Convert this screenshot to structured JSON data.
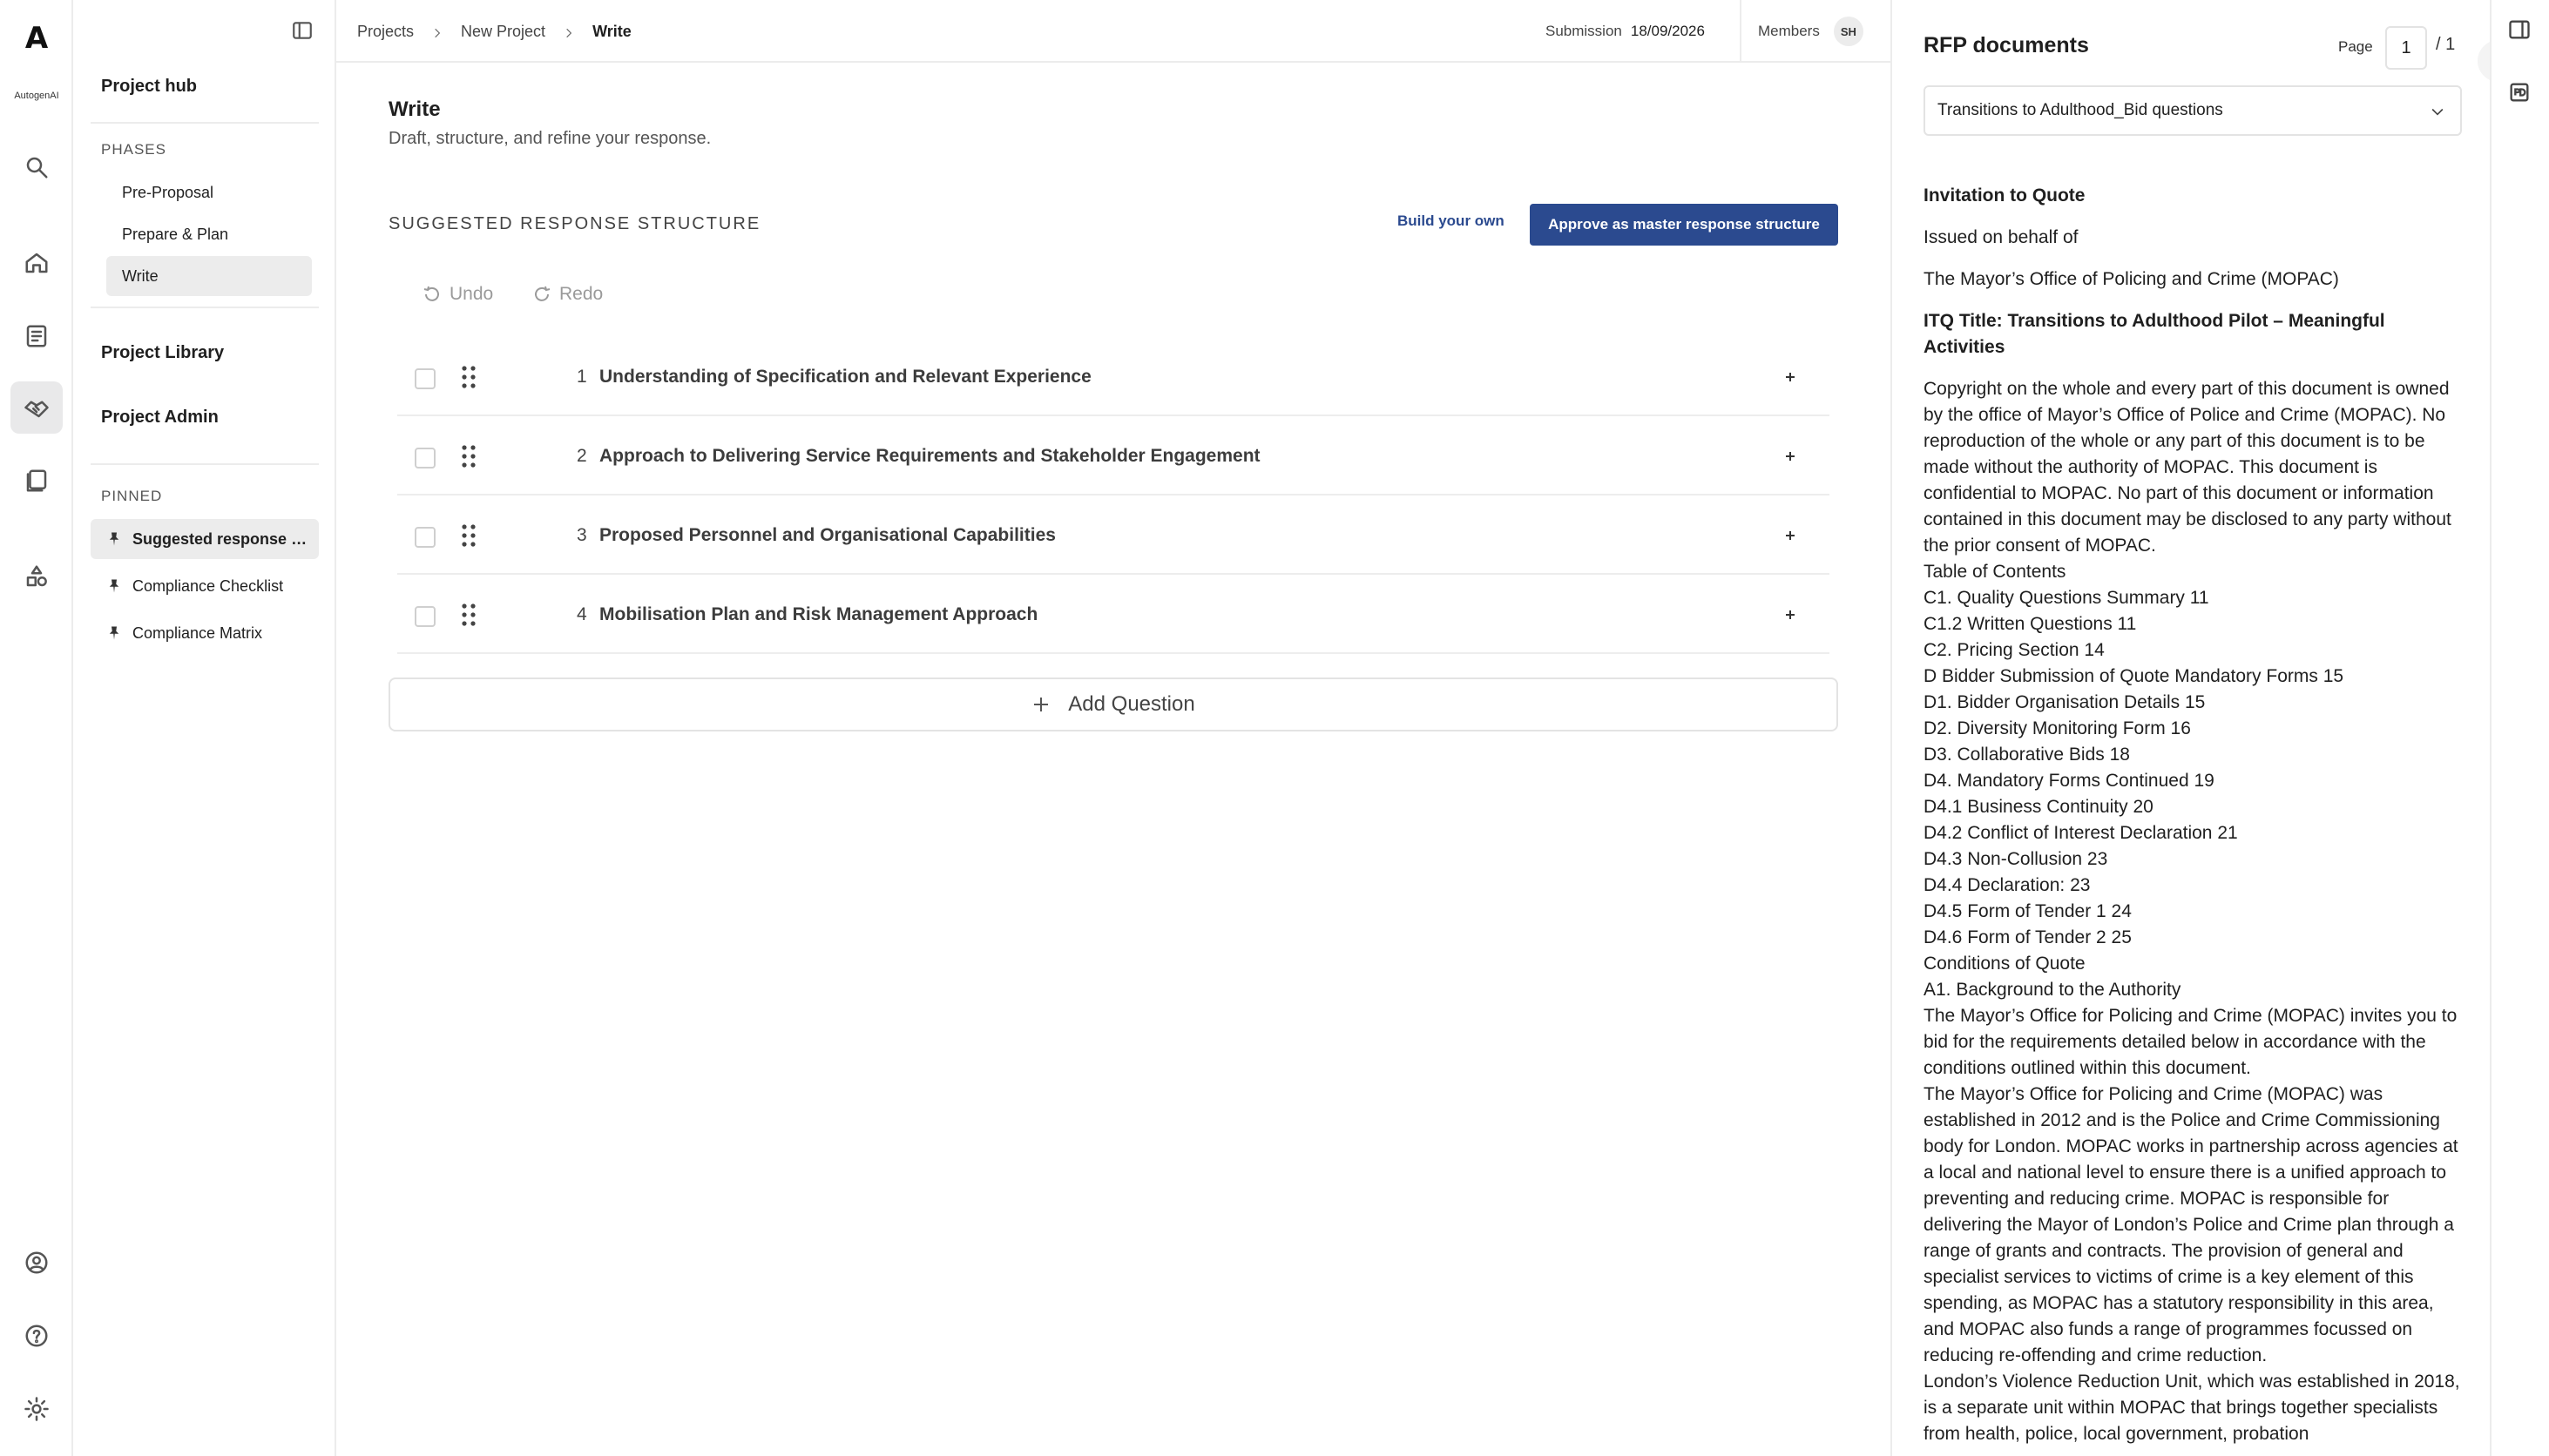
{
  "rail": {
    "brand": "AutogenAI"
  },
  "nav": {
    "project_hub": "Project hub",
    "phases_label": "PHASES",
    "phases": [
      "Pre-Proposal",
      "Prepare & Plan",
      "Write"
    ],
    "project_library": "Project Library",
    "project_admin": "Project Admin",
    "pinned_label": "PINNED",
    "pinned": [
      "Suggested response structure",
      "Compliance Checklist",
      "Compliance Matrix"
    ]
  },
  "topbar": {
    "crumbs": [
      "Projects",
      "New Project",
      "Write"
    ],
    "submission_label": "Submission",
    "submission_date": "18/09/2026",
    "members_label": "Members",
    "avatar_initials": "SH"
  },
  "main": {
    "title": "Write",
    "subtitle": "Draft, structure, and refine your response.",
    "section_title": "SUGGESTED RESPONSE STRUCTURE",
    "build_own": "Build your own",
    "approve": "Approve as master response structure",
    "undo": "Undo",
    "redo": "Redo",
    "rows": [
      {
        "num": "1",
        "text": "Understanding of Specification and Relevant Experience"
      },
      {
        "num": "2",
        "text": "Approach to Delivering Service Requirements and Stakeholder Engagement"
      },
      {
        "num": "3",
        "text": "Proposed Personnel and Organisational Capabilities"
      },
      {
        "num": "4",
        "text": "Mobilisation Plan and Risk Management Approach"
      }
    ],
    "add_question": "Add Question"
  },
  "rfp": {
    "title": "RFP documents",
    "page_label": "Page",
    "page_current": "1",
    "page_total": "/ 1",
    "selected_doc": "Transitions to Adulthood_Bid questions",
    "doc": {
      "heading": "Invitation to Quote",
      "issued": "Issued on behalf of",
      "org": "The Mayor’s Office of Policing and Crime (MOPAC)",
      "itq_title": "ITQ Title: Transitions to Adulthood Pilot – Meaningful Activities",
      "copyright": "Copyright on the whole and every part of this document is owned by the office of Mayor’s Office of Police and Crime (MOPAC). No reproduction of the whole or any part of this document is to be made without the authority of MOPAC. This document is confidential to MOPAC. No part of this document or information contained in this document may be disclosed to any party without the prior consent of MOPAC.",
      "lines": [
        "Table of Contents",
        "C1. Quality Questions Summary 11",
        "C1.2 Written Questions 11",
        "C2. Pricing Section 14",
        "D Bidder Submission of Quote Mandatory Forms 15",
        "D1. Bidder Organisation Details 15",
        "D2. Diversity Monitoring Form 16",
        "D3. Collaborative Bids 18",
        "D4. Mandatory Forms Continued 19",
        "D4.1 Business Continuity 20",
        "D4.2 Conflict of Interest Declaration 21",
        "D4.3 Non-Collusion 23",
        "D4.4 Declaration: 23",
        "D4.5 Form of Tender 1 24",
        "D4.6 Form of Tender 2 25",
        "Conditions of Quote",
        "A1. Background to the Authority"
      ],
      "para1": "The Mayor’s Office for Policing and Crime (MOPAC) invites you to bid for the requirements detailed below in accordance with the conditions outlined within this document.",
      "para2": "The Mayor’s Office for Policing and Crime (MOPAC) was established in 2012 and is the Police and Crime Commissioning body for London. MOPAC works in partnership across agencies at a local and national level to ensure there is a unified approach to preventing and reducing crime. MOPAC is responsible for delivering the Mayor of London’s Police and Crime plan through a range of grants and contracts. The provision of general and specialist services to victims of crime is a key element of this spending, as MOPAC has a statutory responsibility in this area, and MOPAC also funds a range of programmes focussed on reducing re-offending and crime reduction.",
      "para3": "London’s Violence Reduction Unit, which was established in 2018, is a separate unit within MOPAC that brings together specialists from health, police, local government, probation"
    }
  }
}
